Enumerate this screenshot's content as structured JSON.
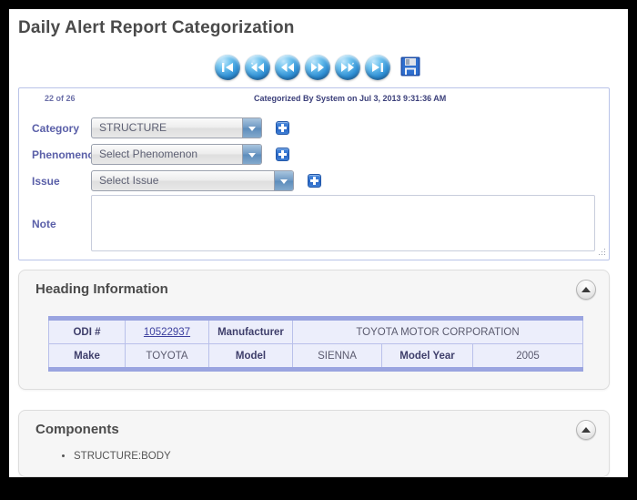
{
  "page": {
    "title": "Daily Alert Report Categorization"
  },
  "toolbar": {
    "buttons": [
      {
        "name": "first-record",
        "icon": "skip-to-start-icon",
        "label": "First"
      },
      {
        "name": "jump-back",
        "icon": "rewind-fast-icon",
        "label": "Jump Back"
      },
      {
        "name": "previous-record",
        "icon": "rewind-icon",
        "label": "Previous"
      },
      {
        "name": "next-record",
        "icon": "forward-icon",
        "label": "Next"
      },
      {
        "name": "jump-forward",
        "icon": "fast-forward-icon",
        "label": "Jump Forward"
      },
      {
        "name": "last-record",
        "icon": "skip-to-end-icon",
        "label": "Last"
      }
    ],
    "save": {
      "name": "save-record",
      "icon": "floppy-disk-save-icon",
      "label": "Save"
    }
  },
  "form": {
    "record_counter": "22 of 26",
    "categorized_by": "Categorized By System  on Jul 3, 2013 9:31:36 AM",
    "fields": [
      {
        "label": "Category",
        "value": "STRUCTURE",
        "add_label": "Add Category"
      },
      {
        "label": "Phenomenon",
        "value": "Select Phenomenon",
        "add_label": "Add Phenomenon"
      },
      {
        "label": "Issue",
        "value": "Select Issue",
        "add_label": "Add Issue"
      }
    ],
    "note": {
      "label": "Note",
      "value": "",
      "placeholder": ""
    }
  },
  "heading_panel": {
    "title": "Heading Information",
    "collapse_label": "Collapse",
    "table": {
      "row1": {
        "odi_label": "ODI #",
        "odi_value": "10522937",
        "manufacturer_label": "Manufacturer",
        "manufacturer_value": "TOYOTA MOTOR CORPORATION"
      },
      "row2": {
        "make_label": "Make",
        "make_value": "TOYOTA",
        "model_label": "Model",
        "model_value": "SIENNA",
        "model_year_label": "Model Year",
        "model_year_value": "2005"
      }
    }
  },
  "components_panel": {
    "title": "Components",
    "collapse_label": "Collapse",
    "items": [
      {
        "label": "STRUCTURE:BODY"
      }
    ]
  },
  "colors": {
    "accent_blue": "#2f6fce",
    "label_purple": "#5a5fa8",
    "table_border": "#9aa4e0",
    "table_cell_bg": "#eceefb",
    "panel_bg": "#f6f6f6",
    "frame": "#000000"
  }
}
